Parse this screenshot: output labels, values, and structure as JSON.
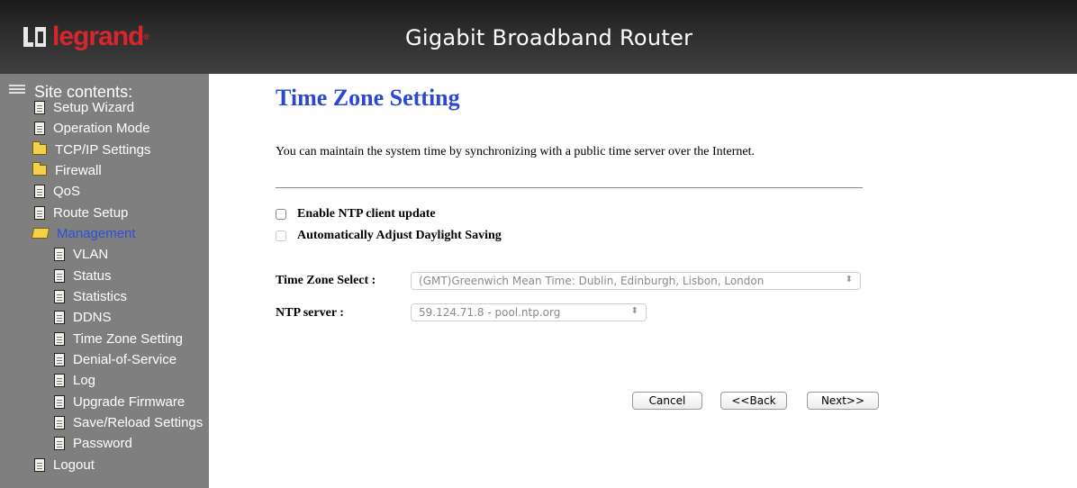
{
  "header": {
    "logo_text": "legrand",
    "logo_mark": "®",
    "title": "Gigabit Broadband Router"
  },
  "sidebar": {
    "heading": "Site contents:",
    "items": [
      {
        "label": "Setup Wizard",
        "icon": "document-icon"
      },
      {
        "label": "Operation Mode",
        "icon": "document-icon"
      },
      {
        "label": "TCP/IP Settings",
        "icon": "folder-icon"
      },
      {
        "label": "Firewall",
        "icon": "folder-icon"
      },
      {
        "label": "QoS",
        "icon": "document-icon"
      },
      {
        "label": "Route Setup",
        "icon": "document-icon"
      },
      {
        "label": "Management",
        "icon": "folder-open-icon",
        "active": true
      },
      {
        "label": "VLAN",
        "icon": "document-icon"
      },
      {
        "label": "Status",
        "icon": "document-icon"
      },
      {
        "label": "Statistics",
        "icon": "document-icon"
      },
      {
        "label": "DDNS",
        "icon": "document-icon"
      },
      {
        "label": "Time Zone Setting",
        "icon": "document-icon"
      },
      {
        "label": "Denial-of-Service",
        "icon": "document-icon"
      },
      {
        "label": "Log",
        "icon": "document-icon"
      },
      {
        "label": "Upgrade Firmware",
        "icon": "document-icon"
      },
      {
        "label": "Save/Reload Settings",
        "icon": "document-icon"
      },
      {
        "label": "Password",
        "icon": "document-icon"
      },
      {
        "label": "Logout",
        "icon": "document-icon"
      }
    ]
  },
  "main": {
    "title": "Time Zone Setting",
    "description": "You can maintain the system time by synchronizing with a public time server over the Internet.",
    "enable_ntp_label": "Enable NTP client update",
    "daylight_label": "Automatically Adjust Daylight Saving",
    "timezone_label": "Time Zone Select :",
    "timezone_value": "(GMT)Greenwich Mean Time: Dublin, Edinburgh, Lisbon, London",
    "ntp_label": "NTP server :",
    "ntp_value": "59.124.71.8 - pool.ntp.org",
    "buttons": {
      "cancel": "Cancel",
      "back": "<<Back",
      "next": "Next>>"
    }
  },
  "colors": {
    "title_blue": "#2a48d2",
    "active_item": "#2f4fd8",
    "logo_red": "#d8262e",
    "sidebar_bg": "#7f7f7f"
  }
}
